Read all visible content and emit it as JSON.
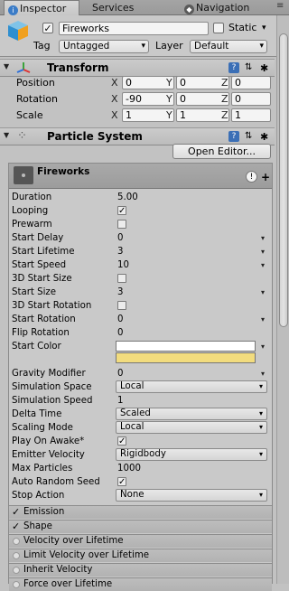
{
  "tabs": [
    {
      "label": "Inspector",
      "active": true
    },
    {
      "label": "Services",
      "active": false
    },
    {
      "label": "Navigation",
      "active": false
    }
  ],
  "gameobject": {
    "active": true,
    "name": "Fireworks",
    "static_label": "Static",
    "static_checked": false,
    "tag_label": "Tag",
    "tag_value": "Untagged",
    "layer_label": "Layer",
    "layer_value": "Default"
  },
  "transform": {
    "title": "Transform",
    "rows": [
      {
        "label": "Position",
        "x": "0",
        "y": "0",
        "z": "0"
      },
      {
        "label": "Rotation",
        "x": "-90",
        "y": "0",
        "z": "0"
      },
      {
        "label": "Scale",
        "x": "1",
        "y": "1",
        "z": "1"
      }
    ],
    "axis": {
      "x": "X",
      "y": "Y",
      "z": "Z"
    }
  },
  "particle_system": {
    "title": "Particle System",
    "open_editor": "Open Editor...",
    "module_name": "Fireworks",
    "properties": [
      {
        "label": "Duration",
        "value": "5.00",
        "kind": "text"
      },
      {
        "label": "Looping",
        "value": "✓",
        "kind": "check"
      },
      {
        "label": "Prewarm",
        "value": "",
        "kind": "check"
      },
      {
        "label": "Start Delay",
        "value": "0",
        "kind": "curve"
      },
      {
        "label": "Start Lifetime",
        "value": "3",
        "kind": "curve"
      },
      {
        "label": "Start Speed",
        "value": "10",
        "kind": "curve"
      },
      {
        "label": "3D Start Size",
        "value": "",
        "kind": "check"
      },
      {
        "label": "Start Size",
        "value": "3",
        "kind": "curve"
      },
      {
        "label": "3D Start Rotation",
        "value": "",
        "kind": "check"
      },
      {
        "label": "Start Rotation",
        "value": "0",
        "kind": "curve"
      },
      {
        "label": "Flip Rotation",
        "value": "0",
        "kind": "text"
      },
      {
        "label": "Start Color",
        "value": "",
        "kind": "color"
      },
      {
        "label": "Gravity Modifier",
        "value": "0",
        "kind": "curve"
      },
      {
        "label": "Simulation Space",
        "value": "Local",
        "kind": "dropdown"
      },
      {
        "label": "Simulation Speed",
        "value": "1",
        "kind": "text"
      },
      {
        "label": "Delta Time",
        "value": "Scaled",
        "kind": "dropdown"
      },
      {
        "label": "Scaling Mode",
        "value": "Local",
        "kind": "dropdown"
      },
      {
        "label": "Play On Awake*",
        "value": "✓",
        "kind": "check"
      },
      {
        "label": "Emitter Velocity",
        "value": "Rigidbody",
        "kind": "dropdown"
      },
      {
        "label": "Max Particles",
        "value": "1000",
        "kind": "text"
      },
      {
        "label": "Auto Random Seed",
        "value": "✓",
        "kind": "check"
      },
      {
        "label": "Stop Action",
        "value": "None",
        "kind": "dropdown"
      }
    ],
    "start_colors": {
      "top": "#ffffff",
      "bottom": "#f2dc7e"
    },
    "modules": [
      {
        "label": "Emission",
        "enabled": true
      },
      {
        "label": "Shape",
        "enabled": true
      },
      {
        "label": "Velocity over Lifetime",
        "enabled": false
      },
      {
        "label": "Limit Velocity over Lifetime",
        "enabled": false
      },
      {
        "label": "Inherit Velocity",
        "enabled": false
      },
      {
        "label": "Force over Lifetime",
        "enabled": false
      }
    ]
  }
}
